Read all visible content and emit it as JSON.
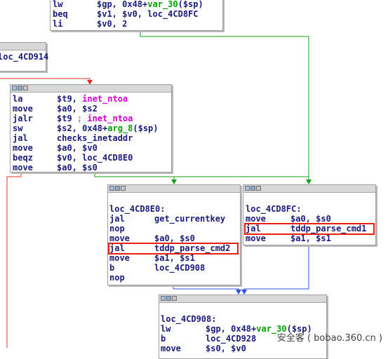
{
  "colors": {
    "edge_red": "#e03030",
    "edge_green": "#10a010",
    "edge_blue": "#3050e0",
    "highlight": "#e82010",
    "mnemonic": "#1a1a7a",
    "function_name": "#d000c8",
    "stack_var": "#00a000"
  },
  "block_top": {
    "lines": [
      {
        "op": "lw",
        "a": "$gp, 0x48+",
        "b": "var_30",
        "c": "($sp)"
      },
      {
        "op": "beq",
        "a": "$v1, $v0, loc_4CD8FC"
      },
      {
        "op": "li",
        "a": "$v0, 2"
      }
    ]
  },
  "block_left": {
    "label": "loc_4CD914"
  },
  "block_middle": {
    "lines": [
      {
        "op": "la",
        "a": "$t9, ",
        "fn": "inet_ntoa"
      },
      {
        "op": "move",
        "a": "$a0, $s2"
      },
      {
        "op": "jalr",
        "a": "$t9 ",
        "cm": "; ",
        "fn": "inet_ntoa"
      },
      {
        "op": "sw",
        "a": "$s2, 0x48+",
        "b": "arg_8",
        "c": "($sp)"
      },
      {
        "op": "jal",
        "a": "checks_inetaddr"
      },
      {
        "op": "move",
        "a": "$a0, $v0"
      },
      {
        "op": "beqz",
        "a": "$v0, loc_4CD8E0"
      },
      {
        "op": "move",
        "a": "$a0, $s0"
      }
    ]
  },
  "block_e0": {
    "label": "loc_4CD8E0:",
    "lines": [
      {
        "op": "jal",
        "a": "get_currentkey"
      },
      {
        "op": "nop",
        "a": ""
      },
      {
        "op": "move",
        "a": "$a0, $s0"
      },
      {
        "op": "jal",
        "a": "tddp_parse_cmd2"
      },
      {
        "op": "move",
        "a": "$a1, $s1"
      },
      {
        "op": "b",
        "a": "loc_4CD908"
      },
      {
        "op": "nop",
        "a": ""
      }
    ]
  },
  "block_fc": {
    "label": "loc_4CD8FC:",
    "lines": [
      {
        "op": "move",
        "a": "$a0, $s0"
      },
      {
        "op": "jal",
        "a": "tddp_parse_cmd1"
      },
      {
        "op": "move",
        "a": "$a1, $s1"
      }
    ]
  },
  "block_908": {
    "label": "loc_4CD908:",
    "lines": [
      {
        "op": "lw",
        "a": "$gp, 0x48+",
        "b": "var_30",
        "c": "($sp)"
      },
      {
        "op": "b",
        "a": "loc_4CD928"
      },
      {
        "op": "move",
        "a": "$s0, $v0"
      }
    ]
  },
  "watermark": "安全客 ( bobao.360.cn )"
}
